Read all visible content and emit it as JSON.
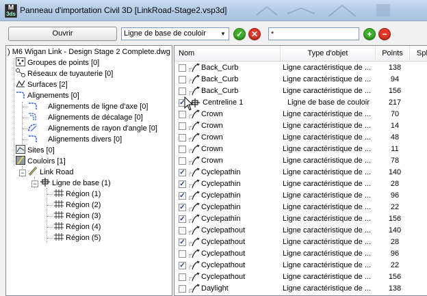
{
  "window": {
    "title": "Panneau d'importation Civil 3D [LinkRoad-Stage2.vsp3d]",
    "app_icon_top": "M",
    "app_icon_bottom": "3ds"
  },
  "toolbar": {
    "open_label": "Ouvrir",
    "type_select_value": "Ligne de base de couloir",
    "filter_value": "*",
    "ok_icon": "check-icon",
    "cancel_icon": "x-icon",
    "add_icon": "plus-icon",
    "remove_icon": "minus-icon"
  },
  "tree": {
    "root": ") M6 Wigan Link - Design Stage 2 Complete.dwg",
    "point_groups": "Groupes de points [0]",
    "pipe_networks": "Réseaux de tuyauterie [0]",
    "surfaces": "Surfaces [2]",
    "alignments": "Alignements [0]",
    "align_centerline": "Alignements de ligne d'axe [0]",
    "align_offset": "Alignements de décalage [0]",
    "align_curb_return": "Alignements de rayon d'angle [0]",
    "align_misc": "Alignements divers [0]",
    "sites": "Sites [0]",
    "corridors": "Couloirs [1]",
    "corridor_link_road": "Link Road",
    "baseline": "Ligne de base (1)",
    "regions": [
      "Région (1)",
      "Région (2)",
      "Région (3)",
      "Région (4)",
      "Région (5)"
    ]
  },
  "grid": {
    "columns": {
      "name": "Nom",
      "type": "Type d'objet",
      "points": "Points",
      "split": "Split"
    },
    "rows": [
      {
        "checked": false,
        "name": "Back_Curb",
        "type": "Ligne caractéristique de ...",
        "points": "138",
        "kind": "feature"
      },
      {
        "checked": false,
        "name": "Back_Curb",
        "type": "Ligne caractéristique de ...",
        "points": "94",
        "kind": "feature"
      },
      {
        "checked": false,
        "name": "Back_Curb",
        "type": "Ligne caractéristique de ...",
        "points": "156",
        "kind": "feature"
      },
      {
        "checked": true,
        "name": "Centreline 1",
        "type": "Ligne de base de couloir",
        "points": "217",
        "kind": "baseline"
      },
      {
        "checked": false,
        "name": "Crown",
        "type": "Ligne caractéristique de ...",
        "points": "70",
        "kind": "feature"
      },
      {
        "checked": false,
        "name": "Crown",
        "type": "Ligne caractéristique de ...",
        "points": "14",
        "kind": "feature"
      },
      {
        "checked": false,
        "name": "Crown",
        "type": "Ligne caractéristique de ...",
        "points": "48",
        "kind": "feature"
      },
      {
        "checked": false,
        "name": "Crown",
        "type": "Ligne caractéristique de ...",
        "points": "11",
        "kind": "feature"
      },
      {
        "checked": false,
        "name": "Crown",
        "type": "Ligne caractéristique de ...",
        "points": "78",
        "kind": "feature"
      },
      {
        "checked": true,
        "name": "Cyclepathin",
        "type": "Ligne caractéristique de ...",
        "points": "140",
        "kind": "feature"
      },
      {
        "checked": true,
        "name": "Cyclepathin",
        "type": "Ligne caractéristique de ...",
        "points": "28",
        "kind": "feature"
      },
      {
        "checked": true,
        "name": "Cyclepathin",
        "type": "Ligne caractéristique de ...",
        "points": "96",
        "kind": "feature"
      },
      {
        "checked": true,
        "name": "Cyclepathin",
        "type": "Ligne caractéristique de ...",
        "points": "22",
        "kind": "feature"
      },
      {
        "checked": true,
        "name": "Cyclepathin",
        "type": "Ligne caractéristique de ...",
        "points": "156",
        "kind": "feature"
      },
      {
        "checked": false,
        "name": "Cyclepathout",
        "type": "Ligne caractéristique de ...",
        "points": "140",
        "kind": "feature"
      },
      {
        "checked": true,
        "name": "Cyclepathout",
        "type": "Ligne caractéristique de ...",
        "points": "28",
        "kind": "feature"
      },
      {
        "checked": false,
        "name": "Cyclepathout",
        "type": "Ligne caractéristique de ...",
        "points": "96",
        "kind": "feature"
      },
      {
        "checked": true,
        "name": "Cyclepathout",
        "type": "Ligne caractéristique de ...",
        "points": "22",
        "kind": "feature"
      },
      {
        "checked": false,
        "name": "Cyclepathout",
        "type": "Ligne caractéristique de ...",
        "points": "156",
        "kind": "feature"
      },
      {
        "checked": false,
        "name": "Daylight",
        "type": "Ligne caractéristique de ...",
        "points": "138",
        "kind": "feature"
      }
    ]
  },
  "colors": {
    "accent_ok": "#3fae2a",
    "accent_cancel": "#e23a2a",
    "checkmark": "#1c3f84"
  }
}
